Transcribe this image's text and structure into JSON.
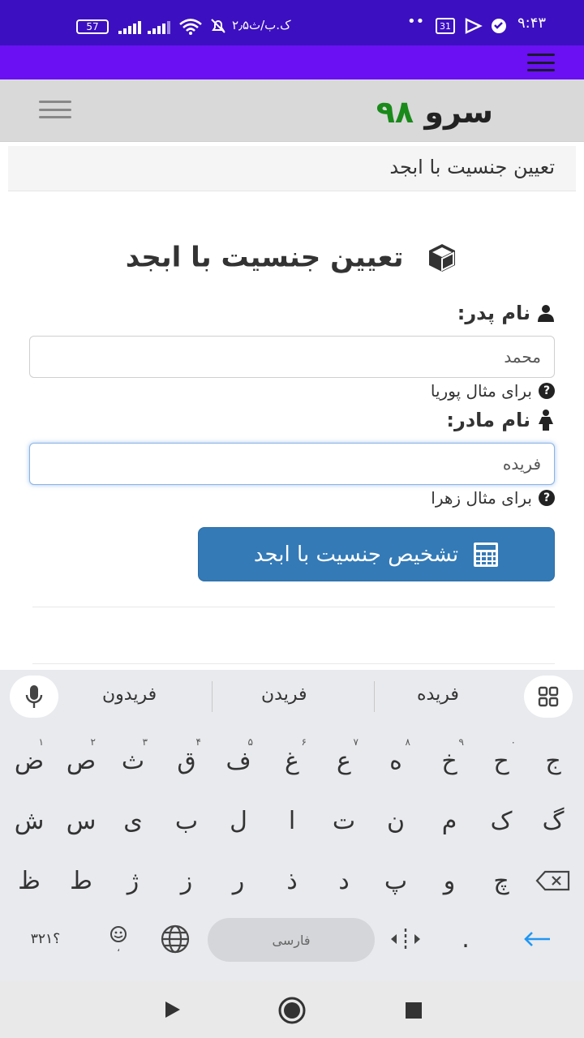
{
  "status_bar": {
    "time": "۹:۴۳",
    "calendar_day": "31",
    "data_speed": "۲٫۵ک.ب/ث",
    "battery": "57"
  },
  "site": {
    "logo_text": "سرو",
    "logo_number": "۹۸"
  },
  "breadcrumb": "تعیین جنسیت با ابجد",
  "form": {
    "title": "تعیین جنسیت با ابجد",
    "father_label": "نام پدر:",
    "father_value": "محمد",
    "father_hint": "برای مثال پوریا",
    "mother_label": "نام مادر:",
    "mother_value": "فریده",
    "mother_hint": "برای مثال زهرا",
    "submit_label": "تشخیص جنسیت با ابجد"
  },
  "keyboard": {
    "suggestions": [
      "فریده",
      "فریدن",
      "فریدون"
    ],
    "row1": [
      {
        "k": "ج",
        "n": ""
      },
      {
        "k": "ح",
        "n": "۰"
      },
      {
        "k": "خ",
        "n": "۹"
      },
      {
        "k": "ه",
        "n": "۸"
      },
      {
        "k": "ع",
        "n": "۷"
      },
      {
        "k": "غ",
        "n": "۶"
      },
      {
        "k": "ف",
        "n": "۵"
      },
      {
        "k": "ق",
        "n": "۴"
      },
      {
        "k": "ث",
        "n": "۳"
      },
      {
        "k": "ص",
        "n": "۲"
      },
      {
        "k": "ض",
        "n": "۱"
      }
    ],
    "row2": [
      "گ",
      "ک",
      "م",
      "ن",
      "ت",
      "ا",
      "ل",
      "ب",
      "ی",
      "س",
      "ش"
    ],
    "row3": [
      "چ",
      "و",
      "پ",
      "د",
      "ذ",
      "ر",
      "ز",
      "ژ",
      "ط",
      "ظ"
    ],
    "symbols_key": "؟۳۲۱",
    "space_label": "فارسی",
    "period_key": "."
  },
  "icons": [
    "hamburger-icon",
    "cube-icon",
    "user-icon",
    "female-icon",
    "question-icon",
    "calculator-icon",
    "mic-icon",
    "grid-icon",
    "backspace-icon",
    "globe-icon",
    "emoji-icon",
    "cursor-move-icon",
    "enter-arrow-icon",
    "back-triangle-icon",
    "home-circle-icon",
    "recents-square-icon"
  ],
  "colors": {
    "status_bar": "#3c10c0",
    "app_bar": "#6a10f2",
    "logo_green": "#1a8a1a",
    "button": "#337ab7",
    "enter_arrow": "#2196f3"
  }
}
